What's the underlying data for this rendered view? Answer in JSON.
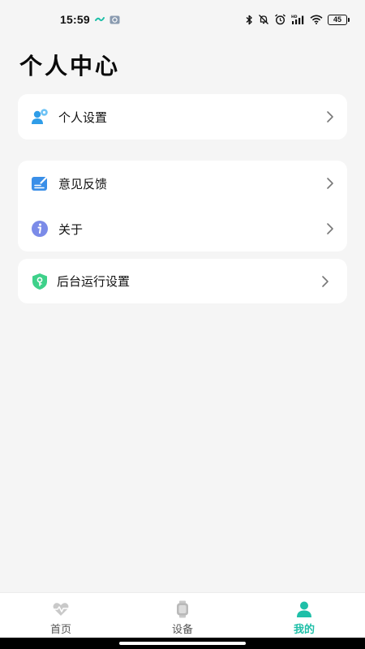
{
  "status_bar": {
    "time": "15:59",
    "battery": "45"
  },
  "page": {
    "title": "个人中心"
  },
  "menu": {
    "personal_settings": {
      "label": "个人设置",
      "icon": "user-gear-icon"
    },
    "feedback": {
      "label": "意见反馈",
      "icon": "feedback-icon"
    },
    "about": {
      "label": "关于",
      "icon": "info-icon"
    },
    "background_run": {
      "label": "后台运行设置",
      "icon": "shield-icon"
    }
  },
  "tabbar": {
    "tabs": [
      {
        "label": "首页",
        "icon": "heart-pulse-icon",
        "active": false
      },
      {
        "label": "设备",
        "icon": "watch-icon",
        "active": false
      },
      {
        "label": "我的",
        "icon": "person-icon",
        "active": true
      }
    ]
  },
  "colors": {
    "accent": "#1fbfa8",
    "background": "#f5f5f5",
    "card": "#ffffff"
  }
}
